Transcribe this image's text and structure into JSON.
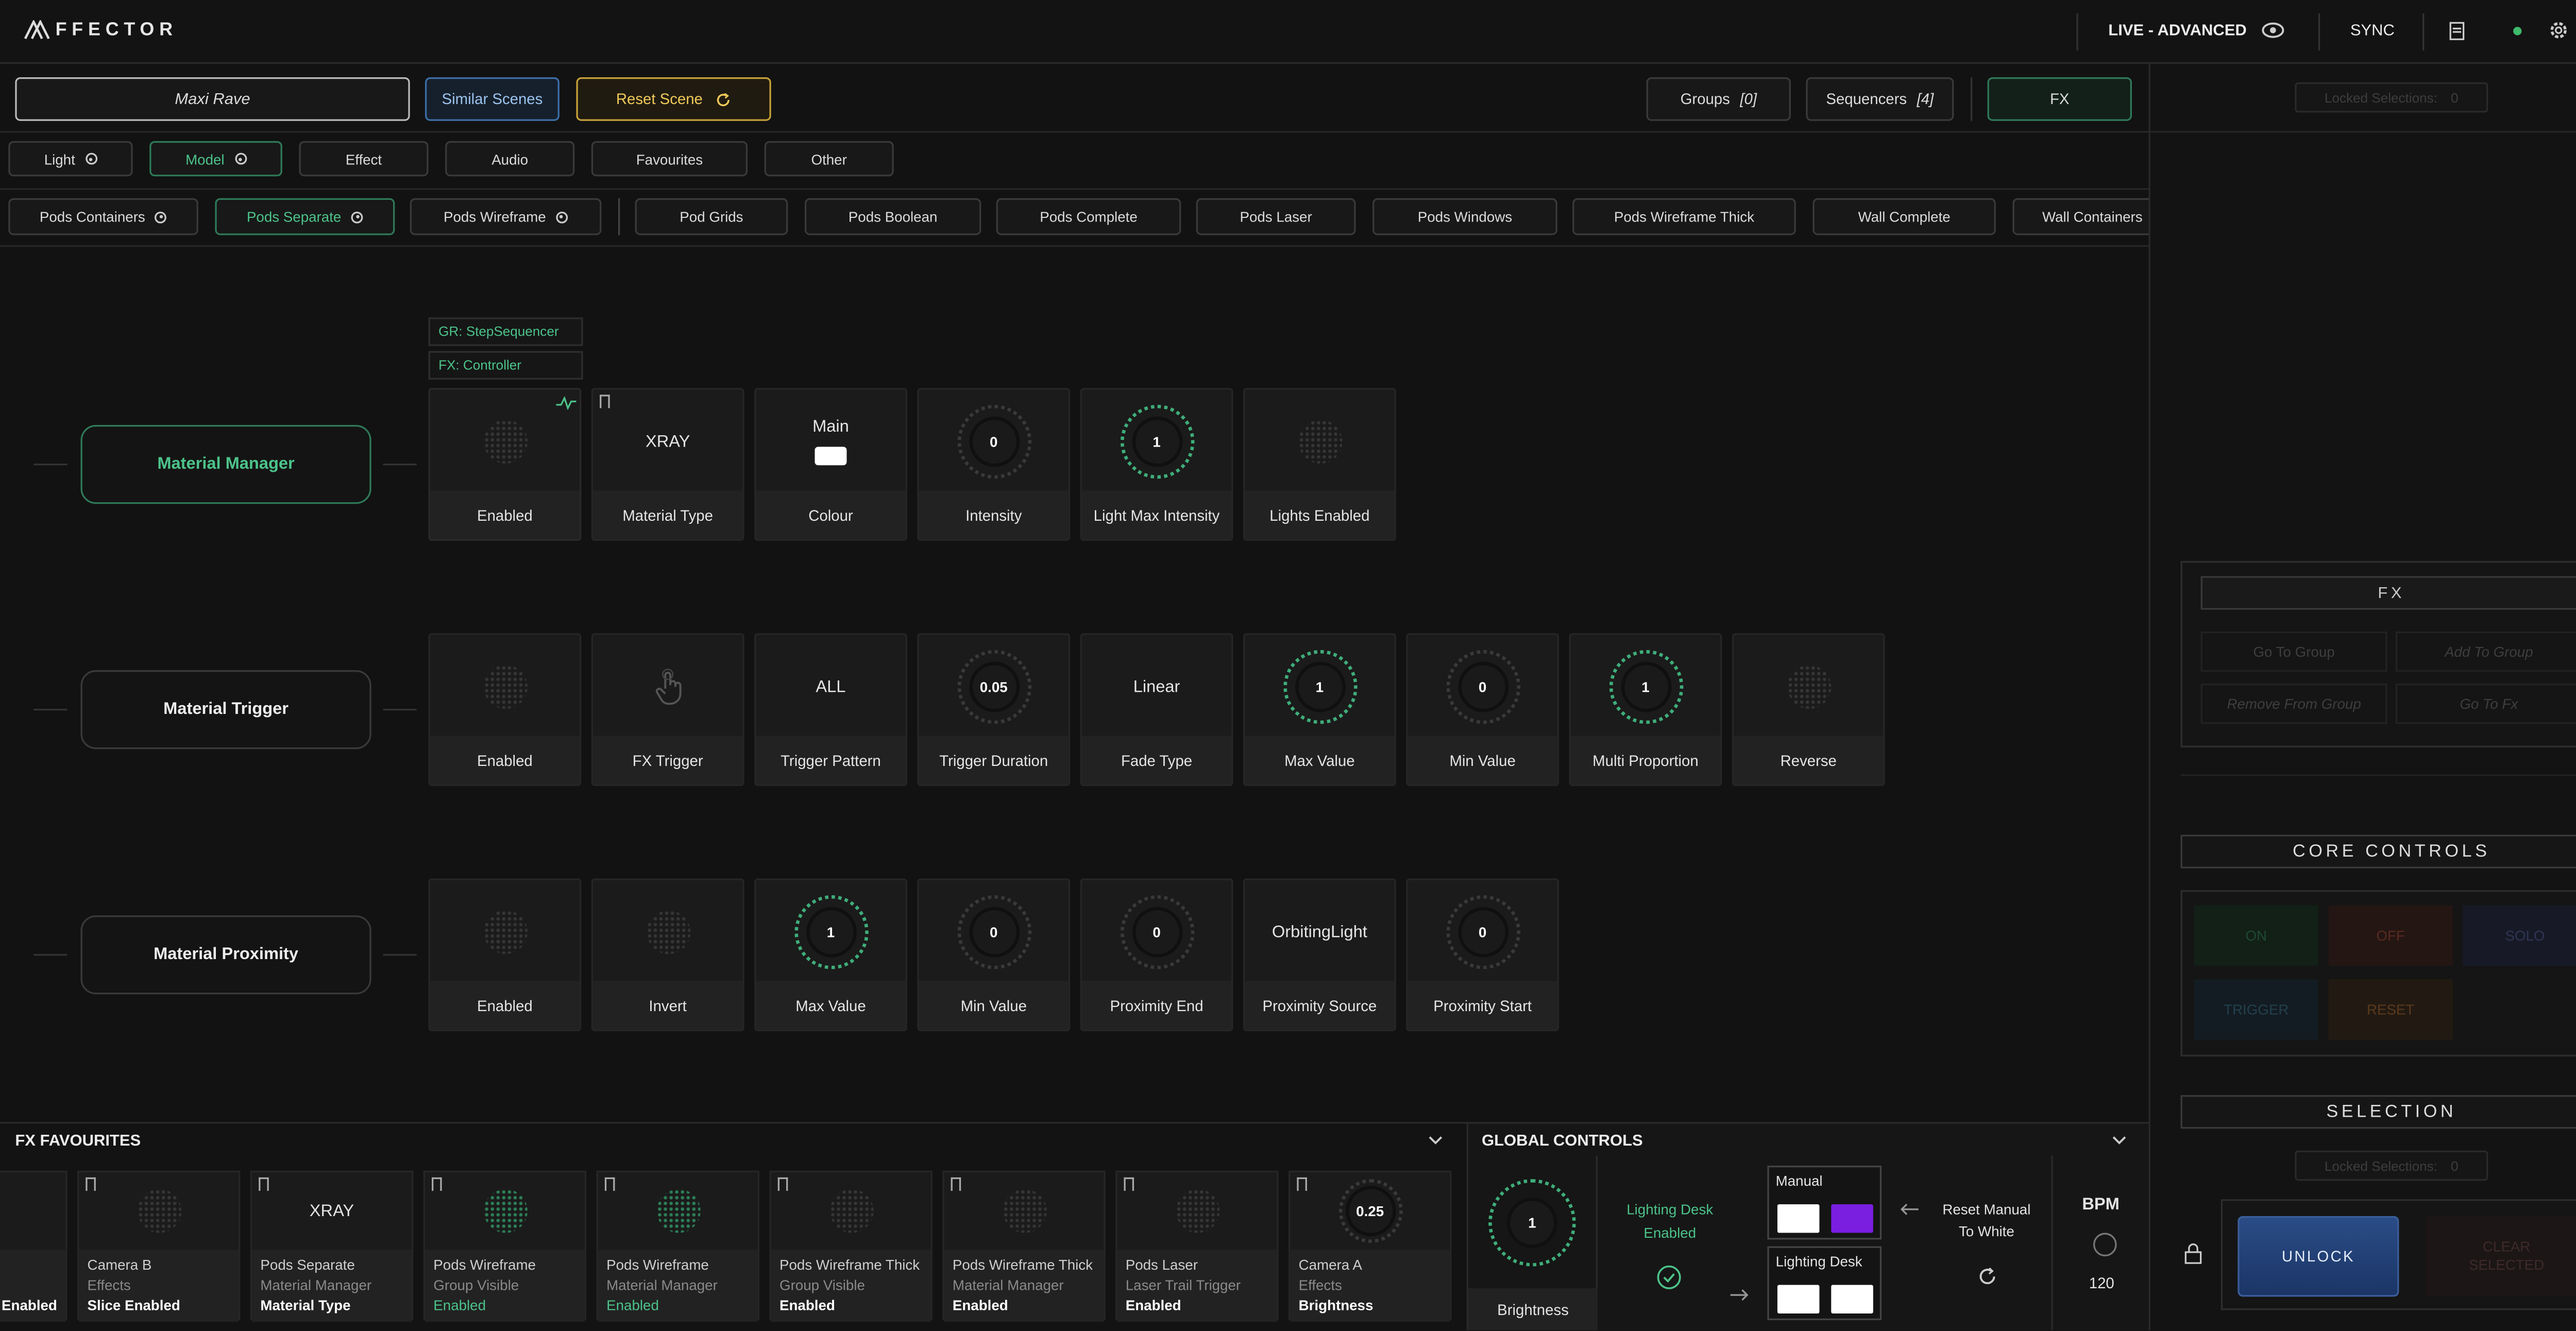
{
  "header": {
    "logo": "FFECTOR",
    "mode": "LIVE - ADVANCED",
    "sync": "SYNC"
  },
  "toolbar": {
    "scene_name": "Maxi Rave",
    "similar": "Similar Scenes",
    "reset": "Reset Scene",
    "groups": "Groups",
    "groups_count": "[0]",
    "sequencers": "Sequencers",
    "sequencers_count": "[4]",
    "fx": "FX"
  },
  "categories": [
    "Light",
    "Model",
    "Effect",
    "Audio",
    "Favourites",
    "Other"
  ],
  "subcategories": [
    "Pods Containers",
    "Pods Separate",
    "Pods Wireframe",
    "Pod Grids",
    "Pods Boolean",
    "Pods Complete",
    "Pods Laser",
    "Pods Windows",
    "Pods Wireframe Thick",
    "Wall Complete",
    "Wall Containers"
  ],
  "tags": {
    "gr": "GR: StepSequencer",
    "fx": "FX: Controller"
  },
  "material_manager": {
    "title": "Material Manager",
    "cards": [
      {
        "top": "",
        "label": "Enabled"
      },
      {
        "top": "XRAY",
        "label": "Material Type"
      },
      {
        "top": "Main",
        "label": "Colour"
      },
      {
        "top": "0",
        "label": "Intensity"
      },
      {
        "top": "1",
        "label": "Light Max Intensity"
      },
      {
        "top": "",
        "label": "Lights Enabled"
      }
    ]
  },
  "material_trigger": {
    "title": "Material Trigger",
    "cards": [
      {
        "top": "",
        "label": "Enabled"
      },
      {
        "top": "",
        "label": "FX Trigger"
      },
      {
        "top": "ALL",
        "label": "Trigger Pattern"
      },
      {
        "top": "0.05",
        "label": "Trigger Duration"
      },
      {
        "top": "Linear",
        "label": "Fade Type"
      },
      {
        "top": "1",
        "label": "Max Value"
      },
      {
        "top": "0",
        "label": "Min Value"
      },
      {
        "top": "1",
        "label": "Multi Proportion"
      },
      {
        "top": "",
        "label": "Reverse"
      }
    ]
  },
  "material_proximity": {
    "title": "Material Proximity",
    "cards": [
      {
        "top": "",
        "label": "Enabled"
      },
      {
        "top": "",
        "label": "Invert"
      },
      {
        "top": "1",
        "label": "Max Value"
      },
      {
        "top": "0",
        "label": "Min Value"
      },
      {
        "top": "0",
        "label": "Proximity End"
      },
      {
        "top": "OrbitingLight",
        "label": "Proximity Source"
      },
      {
        "top": "0",
        "label": "Proximity Start"
      }
    ]
  },
  "fx_favourites": {
    "title": "FX FAVOURITES",
    "items": [
      {
        "l1": "",
        "l2": "",
        "l3": "Enabled",
        "top": ""
      },
      {
        "l1": "Camera B",
        "l2": "Effects",
        "l3": "Slice Enabled",
        "top": ""
      },
      {
        "l1": "Pods Separate",
        "l2": "Material Manager",
        "l3": "Material Type",
        "top": "XRAY"
      },
      {
        "l1": "Pods Wireframe",
        "l2": "Group Visible",
        "l3": "Enabled",
        "top": ""
      },
      {
        "l1": "Pods Wireframe",
        "l2": "Material Manager",
        "l3": "Enabled",
        "top": ""
      },
      {
        "l1": "Pods Wireframe Thick",
        "l2": "Group Visible",
        "l3": "Enabled",
        "top": ""
      },
      {
        "l1": "Pods Wireframe Thick",
        "l2": "Material Manager",
        "l3": "Enabled",
        "top": ""
      },
      {
        "l1": "Pods Laser",
        "l2": "Laser Trail Trigger",
        "l3": "Enabled",
        "top": ""
      },
      {
        "l1": "Camera A",
        "l2": "Effects",
        "l3": "Brightness",
        "top": "0.25"
      }
    ]
  },
  "global_controls": {
    "title": "GLOBAL CONTROLS",
    "brightness_value": "1",
    "brightness": "Brightness",
    "lighting_desk": "Lighting Desk",
    "enabled": "Enabled",
    "manual": "Manual",
    "lighting_desk_box": "Lighting Desk",
    "reset_manual": "Reset Manual To White",
    "bpm": "BPM",
    "bpm_value": "120"
  },
  "right_panel": {
    "locked_selections": "Locked Selections:",
    "locked_count": "0",
    "fx_title": "FX",
    "go_to_group": "Go To Group",
    "add_to_group": "Add To Group",
    "remove_from_group": "Remove From Group",
    "go_to_fx": "Go To Fx",
    "core_controls": "CORE CONTROLS",
    "on": "ON",
    "off": "OFF",
    "solo": "SOLO",
    "trigger": "TRIGGER",
    "reset": "RESET",
    "selection": "SELECTION",
    "unlock": "UNLOCK",
    "clear_selected": "CLEAR SELECTED"
  },
  "colors": {
    "accent": "#4cc38a",
    "reset_border": "#c8a13a",
    "similar_border": "#3d6ea8",
    "purple": "#7a1ee0",
    "unlock": "#1d3a6e"
  }
}
